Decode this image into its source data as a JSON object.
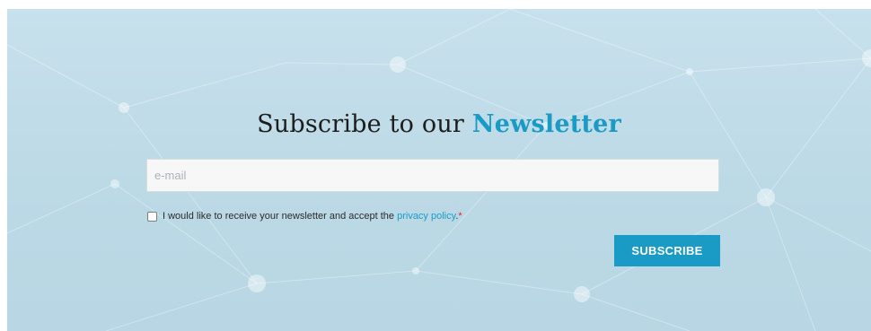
{
  "newsletter": {
    "title_prefix": "Subscribe to our ",
    "title_accent": "Newsletter",
    "email_placeholder": "e-mail",
    "email_value": "",
    "consent_text": "I would like to receive your newsletter and accept the ",
    "privacy_link": "privacy policy",
    "consent_suffix": ".",
    "required_mark": "*",
    "consent_checked": false,
    "subscribe_label": "SUBSCRIBE"
  },
  "colors": {
    "accent": "#1a9bc6",
    "background": "#c2dde9",
    "required": "#e0242c"
  }
}
